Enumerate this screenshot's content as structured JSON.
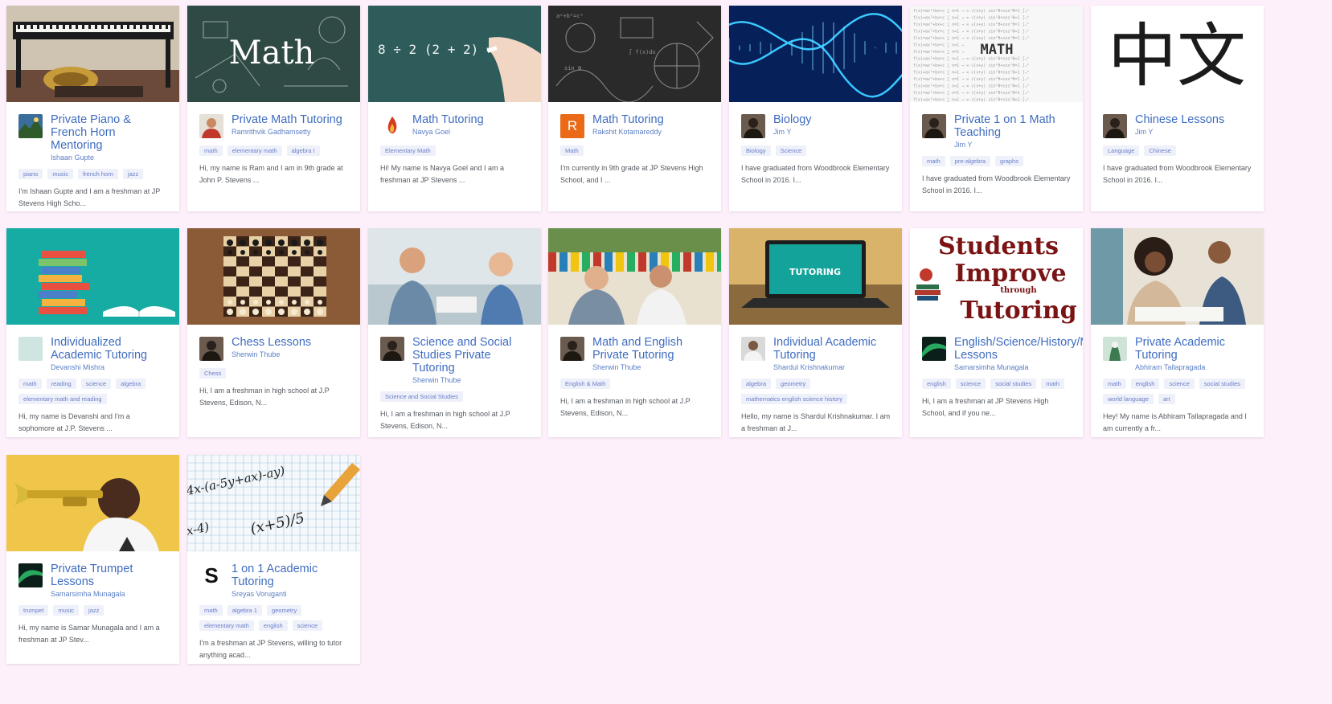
{
  "cards": [
    {
      "title": "Private Piano & French Horn Mentoring",
      "tutor": "Ishaan Gupte",
      "tags": [
        "piano",
        "music",
        "french horn",
        "jazz"
      ],
      "description": "I'm Ishaan Gupte and I am a freshman at JP Stevens High Scho...",
      "image_icon": "piano-icon",
      "avatar_icon": "landscape-avatar"
    },
    {
      "title": "Private Math Tutoring",
      "tutor": "Ramrithvik Gadhamsetty",
      "tags": [
        "math",
        "elementary math",
        "algebra I"
      ],
      "description": "Hi, my name is Ram and I am in 9th grade at John P. Stevens ...",
      "image_icon": "chalkboard-math-icon",
      "avatar_icon": "person-red-avatar",
      "image_text": "Math"
    },
    {
      "title": "Math Tutoring",
      "tutor": "Navya Goel",
      "tags": [
        "Elementary Math"
      ],
      "description": "Hi! My name is Navya Goel and I am a freshman at JP Stevens ...",
      "image_icon": "chalkboard-equation-icon",
      "avatar_icon": "flame-avatar",
      "image_text": "8 ÷ 2 (2 + 2) ="
    },
    {
      "title": "Math Tutoring",
      "tutor": "Rakshit Kotamareddy",
      "tags": [
        "Math"
      ],
      "description": "I'm currently in 9th grade at JP Stevens High School, and I ...",
      "image_icon": "math-doodle-icon",
      "avatar_icon": "letter-avatar",
      "avatar_letter": "R"
    },
    {
      "title": "Biology",
      "tutor": "Jim Y",
      "tags": [
        "Biology",
        "Science"
      ],
      "description": "I have graduated from Woodbrook Elementary School in 2016. I...",
      "image_icon": "dna-icon",
      "avatar_icon": "person-dark-avatar"
    },
    {
      "title": "Private 1 on 1 Math Teaching",
      "tutor": "Jim Y",
      "tags": [
        "math",
        "pre-algebra",
        "graphs"
      ],
      "description": "I have graduated from Woodbrook Elementary School in 2016. I...",
      "image_icon": "math-formulas-icon",
      "avatar_icon": "person-dark-avatar",
      "image_text": "MATH"
    },
    {
      "title": "Chinese Lessons",
      "tutor": "Jim Y",
      "tags": [
        "Language",
        "Chinese"
      ],
      "description": "I have graduated from Woodbrook Elementary School in 2016. I...",
      "image_icon": "chinese-characters-icon",
      "avatar_icon": "person-dark-avatar",
      "image_text": "中文"
    },
    {
      "title": "Individualized Academic Tutoring",
      "tutor": "Devanshi Mishra",
      "tags": [
        "math",
        "reading",
        "science",
        "algebra",
        "elementary math and reading"
      ],
      "description": "Hi, my name is Devanshi and I'm a sophomore at J.P. Stevens ...",
      "image_icon": "books-icon",
      "avatar_icon": "blank-avatar"
    },
    {
      "title": "Chess Lessons",
      "tutor": "Sherwin Thube",
      "tags": [
        "Chess"
      ],
      "description": "Hi, I am a freshman in high school at J.P Stevens, Edison, N...",
      "image_icon": "chessboard-icon",
      "avatar_icon": "person-dark-avatar"
    },
    {
      "title": "Science and Social Studies Private Tutoring",
      "tutor": "Sherwin Thube",
      "tags": [
        "Science and Social Studies"
      ],
      "description": "Hi, I am a freshman in high school at J.P Stevens, Edison, N...",
      "image_icon": "tutoring-photo-icon",
      "avatar_icon": "person-dark-avatar"
    },
    {
      "title": "Math and English Private Tutoring",
      "tutor": "Sherwin Thube",
      "tags": [
        "English & Math"
      ],
      "description": "Hi, I am a freshman in high school at J.P Stevens, Edison, N...",
      "image_icon": "classroom-photo-icon",
      "avatar_icon": "person-dark-avatar"
    },
    {
      "title": "Individual Academic Tutoring",
      "tutor": "Shardul Krishnakumar",
      "tags": [
        "algebra",
        "geometry",
        "mathematics english science history"
      ],
      "description": "Hello, my name is Shardul Krishnakumar. I am a freshman at J...",
      "image_icon": "laptop-tutoring-icon",
      "avatar_icon": "person-light-avatar",
      "image_text": "TUTORING"
    },
    {
      "title": "English/Science/History/Math Lessons",
      "tutor": "Samarsimha Munagala",
      "tags": [
        "english",
        "science",
        "social studies",
        "math"
      ],
      "description": "Hi, I am a freshman at JP Stevens High School, and if you ne...",
      "image_icon": "students-improve-icon",
      "avatar_icon": "aurora-avatar",
      "image_text": [
        "Students",
        "Improve",
        "through",
        "Tutoring"
      ]
    },
    {
      "title": "Private Academic Tutoring",
      "tutor": "Abhiram Tallapragada",
      "tags": [
        "math",
        "english",
        "science",
        "social studies",
        "world language",
        "art"
      ],
      "description": "Hey! My name is Abhiram Tallapragada and I am currently a fr...",
      "image_icon": "students-studying-icon",
      "avatar_icon": "nature-avatar"
    },
    {
      "title": "Private Trumpet Lessons",
      "tutor": "Samarsimha Munagala",
      "tags": [
        "trumpet",
        "music",
        "jazz"
      ],
      "description": "Hi, my name is Samar Munagala and I am a freshman at JP Stev...",
      "image_icon": "trumpet-player-icon",
      "avatar_icon": "aurora-avatar"
    },
    {
      "title": "1 on 1 Academic Tutoring",
      "tutor": "Sreyas Voruganti",
      "tags": [
        "math",
        "algebra 1",
        "geometry",
        "elementary math",
        "english",
        "science"
      ],
      "description": "I'm a freshman at JP Stevens, willing to tutor anything acad...",
      "image_icon": "graph-paper-math-icon",
      "avatar_icon": "letter-s-avatar",
      "avatar_letter": "S",
      "image_text": "(x+5)/5"
    }
  ]
}
